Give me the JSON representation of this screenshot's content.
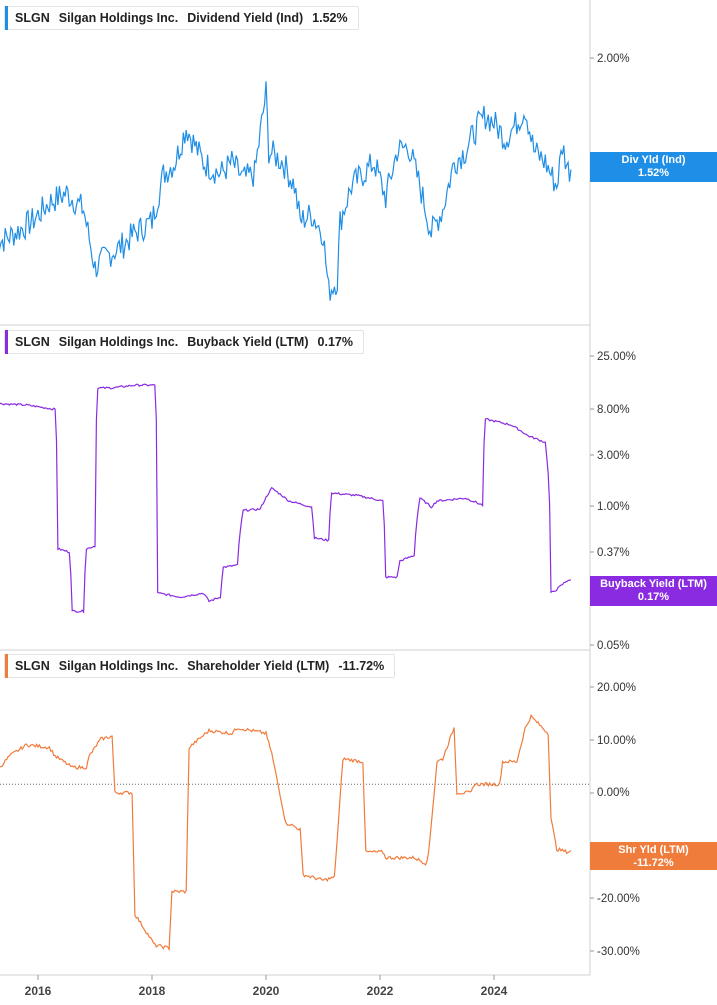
{
  "colors": {
    "div": "#1f8ee6",
    "buyback": "#8a2be2",
    "shr": "#f07c3c"
  },
  "x_ticks": [
    "2016",
    "2018",
    "2020",
    "2022",
    "2024"
  ],
  "chart_data": [
    {
      "type": "line",
      "ticker": "SLGN",
      "company": "Silgan Holdings Inc.",
      "metric": "Dividend Yield (Ind)",
      "last_value": "1.52%",
      "tag_line1": "Div Yld (Ind)",
      "tag_line2": "1.52%",
      "yaxis_ticks": [
        "2.00%"
      ],
      "ylim": [
        0.9,
        2.2
      ],
      "series": [
        {
          "x": [
            2015.25,
            2015.6,
            2015.9,
            2016.2,
            2016.5,
            2016.8,
            2017.0,
            2017.2,
            2017.5,
            2017.7,
            2018.0,
            2018.2,
            2018.4,
            2018.6,
            2018.9,
            2019.2,
            2019.4,
            2019.6,
            2019.8,
            2020.0,
            2020.05,
            2020.3,
            2020.5,
            2020.6,
            2020.8,
            2021.0,
            2021.1,
            2021.25,
            2021.3,
            2021.5,
            2021.7,
            2021.9,
            2022.1,
            2022.3,
            2022.5,
            2022.7,
            2022.9,
            2023.1,
            2023.3,
            2023.5,
            2023.7,
            2023.85,
            2024.0,
            2024.2,
            2024.4,
            2024.55,
            2024.7,
            2024.9,
            2025.1,
            2025.2,
            2025.3,
            2025.35
          ],
          "values": [
            1.2,
            1.25,
            1.3,
            1.38,
            1.42,
            1.35,
            1.1,
            1.15,
            1.2,
            1.25,
            1.3,
            1.5,
            1.55,
            1.7,
            1.55,
            1.5,
            1.55,
            1.48,
            1.5,
            1.85,
            1.6,
            1.55,
            1.45,
            1.3,
            1.33,
            1.25,
            1.0,
            1.05,
            1.3,
            1.45,
            1.5,
            1.55,
            1.4,
            1.6,
            1.62,
            1.45,
            1.25,
            1.35,
            1.55,
            1.6,
            1.7,
            1.75,
            1.72,
            1.65,
            1.72,
            1.78,
            1.6,
            1.55,
            1.45,
            1.62,
            1.52,
            1.52
          ]
        }
      ]
    },
    {
      "type": "line",
      "ticker": "SLGN",
      "company": "Silgan Holdings Inc.",
      "metric": "Buyback Yield (LTM)",
      "last_value": "0.17%",
      "tag_line1": "Buyback Yield (LTM)",
      "tag_line2": "0.17%",
      "yaxis_ticks": [
        "25.00%",
        "8.00%",
        "3.00%",
        "1.00%",
        "0.37%",
        "0.05%"
      ],
      "yscale": "log",
      "ylim": [
        0.05,
        25
      ],
      "series": [
        {
          "x": [
            2015.25,
            2015.8,
            2016.3,
            2016.35,
            2016.55,
            2016.6,
            2016.8,
            2016.85,
            2017.0,
            2017.05,
            2017.3,
            2017.7,
            2018.05,
            2018.1,
            2018.5,
            2018.9,
            2019.0,
            2019.2,
            2019.25,
            2019.5,
            2019.6,
            2019.9,
            2020.1,
            2020.4,
            2020.8,
            2020.85,
            2021.1,
            2021.15,
            2021.6,
            2022.05,
            2022.1,
            2022.3,
            2022.35,
            2022.6,
            2022.7,
            2022.9,
            2023.0,
            2023.5,
            2023.8,
            2023.85,
            2024.3,
            2024.6,
            2024.9,
            2025.0,
            2025.1,
            2025.3,
            2025.35
          ],
          "values": [
            6.2,
            6.0,
            5.5,
            0.32,
            0.3,
            0.09,
            0.09,
            0.32,
            0.34,
            8.5,
            8.5,
            9.0,
            9.0,
            0.13,
            0.12,
            0.13,
            0.11,
            0.12,
            0.22,
            0.23,
            0.7,
            0.72,
            1.1,
            0.85,
            0.75,
            0.4,
            0.38,
            1.0,
            0.95,
            0.85,
            0.18,
            0.18,
            0.25,
            0.28,
            0.9,
            0.75,
            0.85,
            0.9,
            0.78,
            4.5,
            4.0,
            3.2,
            2.8,
            0.13,
            0.14,
            0.17,
            0.17
          ]
        }
      ]
    },
    {
      "type": "line",
      "ticker": "SLGN",
      "company": "Silgan Holdings Inc.",
      "metric": "Shareholder Yield (LTM)",
      "last_value": "-11.72%",
      "tag_line1": "Shr Yld (LTM)",
      "tag_line2": "-11.72%",
      "yaxis_ticks": [
        "20.00%",
        "10.00%",
        "0.00%",
        "-20.00%",
        "-30.00%"
      ],
      "ylim": [
        -32,
        22
      ],
      "series": [
        {
          "x": [
            2015.25,
            2015.5,
            2015.8,
            2016.2,
            2016.3,
            2016.6,
            2016.85,
            2016.9,
            2017.1,
            2017.3,
            2017.35,
            2017.65,
            2017.7,
            2018.05,
            2018.3,
            2018.35,
            2018.6,
            2018.65,
            2019.0,
            2019.4,
            2019.5,
            2020.0,
            2020.1,
            2020.35,
            2020.4,
            2020.6,
            2020.65,
            2021.0,
            2021.2,
            2021.35,
            2021.7,
            2021.75,
            2022.05,
            2022.1,
            2022.6,
            2022.8,
            2022.85,
            2023.0,
            2023.1,
            2023.3,
            2023.35,
            2023.6,
            2023.65,
            2024.1,
            2024.15,
            2024.4,
            2024.55,
            2024.65,
            2024.95,
            2025.0,
            2025.1,
            2025.3,
            2025.35
          ],
          "values": [
            2,
            5,
            7,
            6.5,
            5,
            3,
            3,
            5,
            8,
            8.5,
            -1.5,
            -1.5,
            -23,
            -28.5,
            -29,
            -19,
            -19,
            6.5,
            9.5,
            9,
            10,
            9,
            5.5,
            -7,
            -7,
            -8,
            -16,
            -17,
            -16.5,
            4.5,
            4,
            -12,
            -12,
            -13,
            -13,
            -14,
            -12.5,
            4,
            4.5,
            10,
            -1.5,
            -1.5,
            0,
            0,
            4,
            4,
            10,
            12,
            9,
            -6,
            -11.5,
            -12,
            -11.72
          ]
        }
      ]
    }
  ]
}
